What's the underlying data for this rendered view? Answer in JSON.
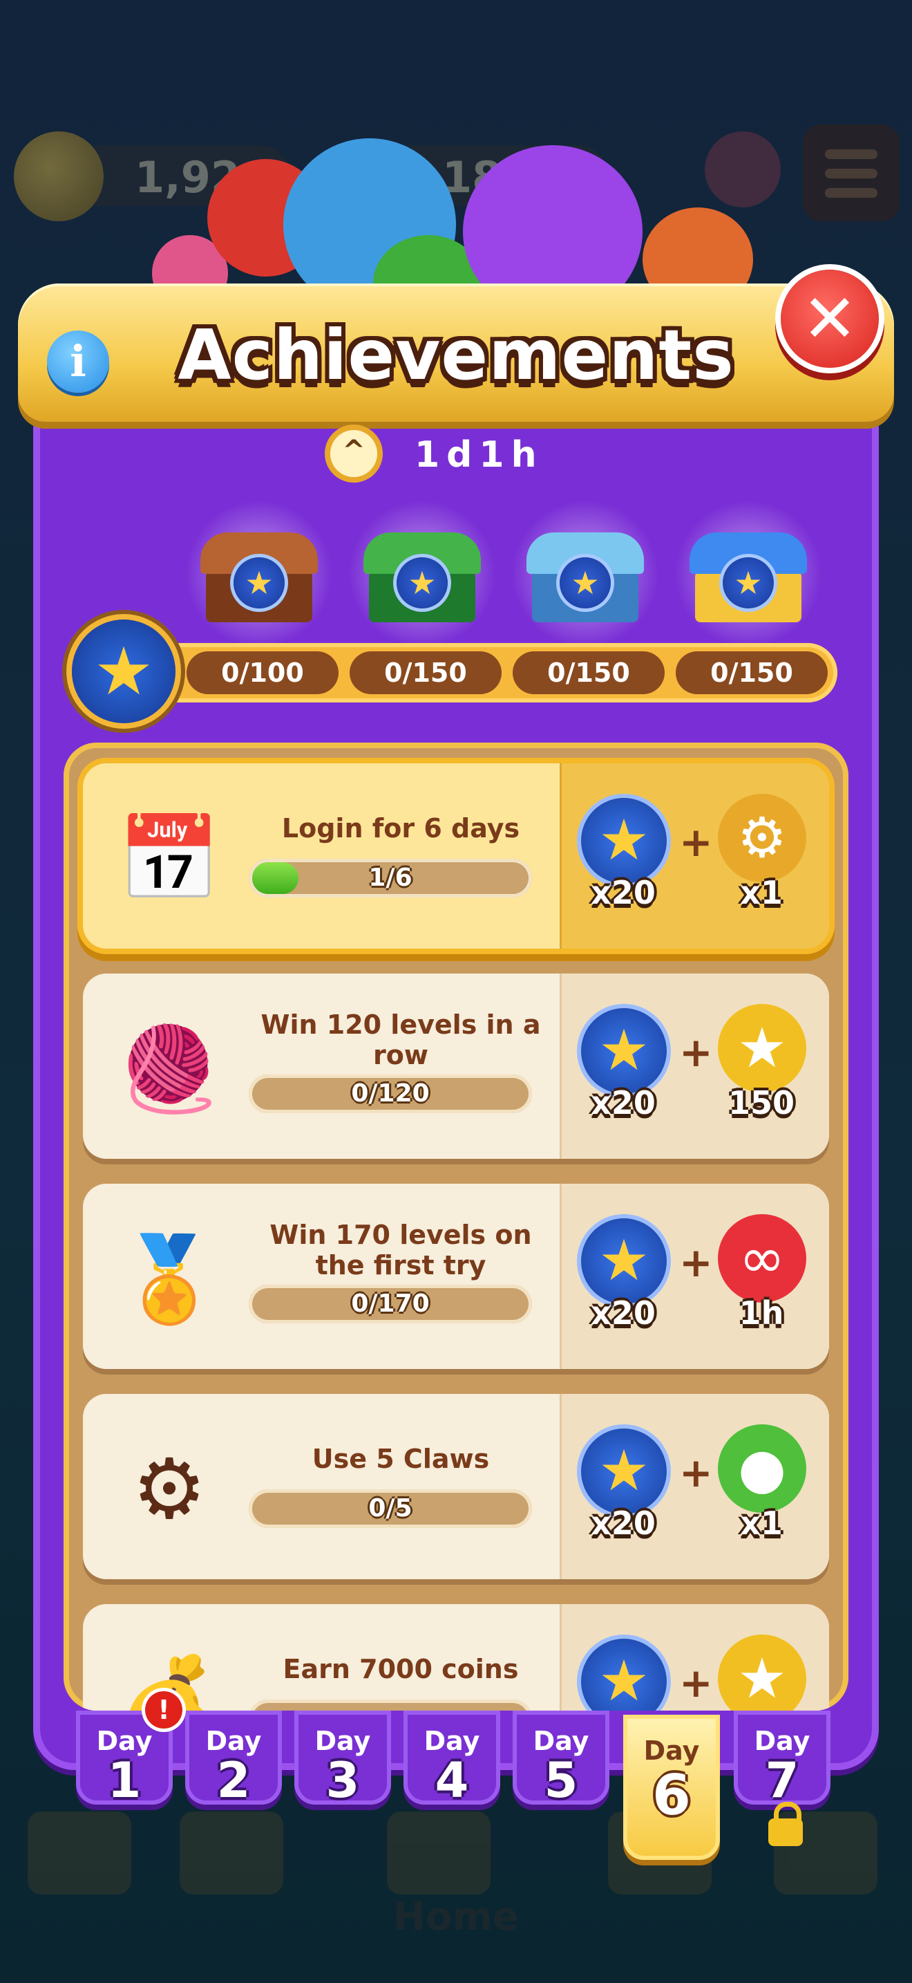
{
  "hud": {
    "coins": "1,920",
    "lives": "18"
  },
  "bottom_nav": {
    "home_label": "Home"
  },
  "header": {
    "title": "Achievements",
    "info_label": "i",
    "close_label": "✕"
  },
  "timer": {
    "icon": "^",
    "text": "1d1h"
  },
  "milestones": {
    "star_icon": "★",
    "chests": [
      {
        "name": "wooden-chest",
        "colors": [
          "#b86332",
          "#7a3a1a"
        ]
      },
      {
        "name": "green-chest",
        "colors": [
          "#43b34a",
          "#1e7a2c"
        ]
      },
      {
        "name": "blue-chest",
        "colors": [
          "#7cc7f0",
          "#3c7fc2"
        ]
      },
      {
        "name": "gold-chest",
        "colors": [
          "#3e8af0",
          "#f4c43a"
        ]
      }
    ],
    "values": [
      "0/100",
      "0/150",
      "0/150",
      "0/150"
    ]
  },
  "tasks": [
    {
      "title": "Login for 6 days",
      "progress_text": "1/6",
      "progress": 0.1667,
      "icon": "calendar-icon",
      "icon_glyph": "📅",
      "reward_star_qty": "x20",
      "reward_item": "claw",
      "reward_item_glyph": "⚙",
      "reward_item_qty": "x1",
      "reward_item_color": "#e8a92b",
      "active": true
    },
    {
      "title": "Win 120 levels in a row",
      "progress_text": "0/120",
      "progress": 0,
      "icon": "yarn-stack-icon",
      "icon_glyph": "🧶",
      "reward_star_qty": "x20",
      "reward_item": "coin",
      "reward_item_glyph": "★",
      "reward_item_qty": "150",
      "reward_item_color": "#f2bf22",
      "active": false
    },
    {
      "title": "Win 170 levels on the first try",
      "progress_text": "0/170",
      "progress": 0,
      "icon": "medal-icon",
      "icon_glyph": "🏅",
      "reward_star_qty": "x20",
      "reward_item": "infinite-life",
      "reward_item_glyph": "∞",
      "reward_item_qty": "1h",
      "reward_item_color": "#e8303a",
      "active": false
    },
    {
      "title": "Use 5 Claws",
      "progress_text": "0/5",
      "progress": 0,
      "icon": "claw-icon",
      "icon_glyph": "⚙",
      "reward_star_qty": "x20",
      "reward_item": "cat-booster",
      "reward_item_glyph": "●",
      "reward_item_qty": "x1",
      "reward_item_color": "#4fbf3c",
      "active": false
    },
    {
      "title": "Earn 7000 coins",
      "progress_text": "",
      "progress": 0,
      "icon": "coin-pot-icon",
      "icon_glyph": "💰",
      "reward_star_qty": "",
      "reward_item": "coin",
      "reward_item_glyph": "★",
      "reward_item_qty": "",
      "reward_item_color": "#f2bf22",
      "active": false
    }
  ],
  "days": [
    {
      "label": "Day",
      "num": "1",
      "alert": "!"
    },
    {
      "label": "Day",
      "num": "2"
    },
    {
      "label": "Day",
      "num": "3"
    },
    {
      "label": "Day",
      "num": "4"
    },
    {
      "label": "Day",
      "num": "5"
    },
    {
      "label": "Day",
      "num": "6",
      "selected": true
    },
    {
      "label": "Day",
      "num": "7",
      "locked": true
    }
  ]
}
